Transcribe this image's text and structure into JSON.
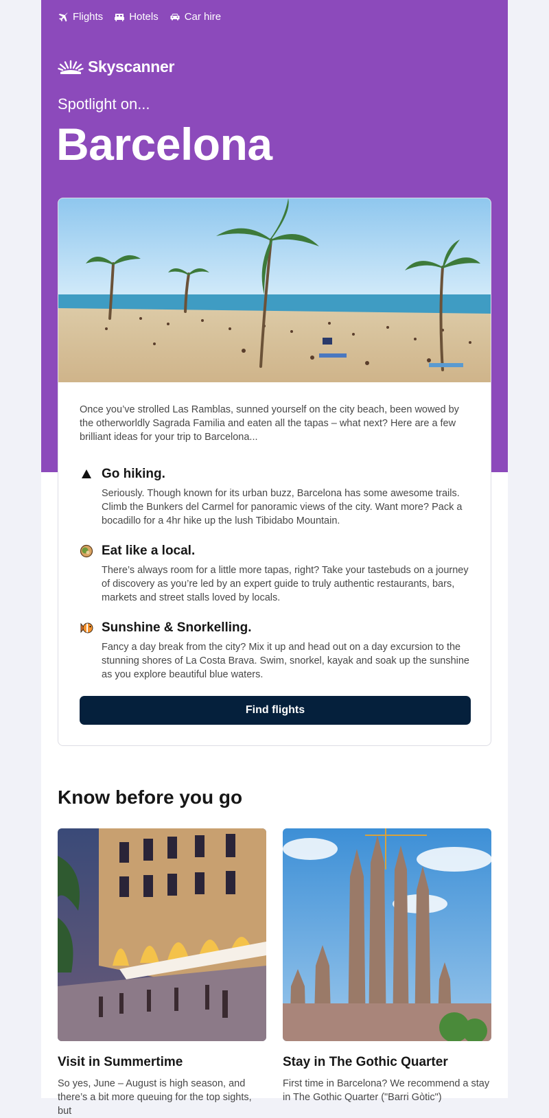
{
  "nav": {
    "items": [
      {
        "label": "Flights",
        "icon": "plane-icon"
      },
      {
        "label": "Hotels",
        "icon": "bed-icon"
      },
      {
        "label": "Car hire",
        "icon": "car-icon"
      }
    ]
  },
  "brand": {
    "name": "Skyscanner",
    "color": "#8c4abb"
  },
  "hero": {
    "kicker": "Spotlight on...",
    "city": "Barcelona"
  },
  "intro": "Once you’ve strolled Las Ramblas, sunned yourself on the city beach, been wowed by the otherworldly Sagrada Familia and eaten all the tapas – what next? Here are a few brilliant ideas for your trip to Barcelona...",
  "tips": [
    {
      "icon": "mountain-icon",
      "title": "Go hiking.",
      "body": "Seriously. Though known for its urban buzz, Barcelona has some awesome trails. Climb the Bunkers del Carmel for panoramic views of the city. Want more? Pack a bocadillo for a 4hr hike up the lush Tibidabo Mountain."
    },
    {
      "icon": "food-bowl-icon",
      "title": "Eat like a local.",
      "body": "There’s always room for a little more tapas, right? Take your tastebuds on a journey of discovery as you’re led by an expert guide to truly authentic restaurants, bars, markets and street stalls loved by locals."
    },
    {
      "icon": "tropical-fish-icon",
      "title": "Sunshine & Snorkelling.",
      "body": "Fancy a day break from the city? Mix it up and head out on a day excursion to the stunning shores of La Costa Brava. Swim, snorkel, kayak and soak up the sunshine as you explore beautiful blue waters."
    }
  ],
  "cta": {
    "label": "Find flights",
    "color": "#05203c"
  },
  "know": {
    "title": "Know before you go",
    "cards": [
      {
        "title": "Visit in Summertime",
        "body": "So yes, June – August is high season, and there’s a bit more queuing for the top sights, but"
      },
      {
        "title": "Stay in The Gothic Quarter",
        "body": "First time in Barcelona? We recommend a stay in The Gothic Quarter (\"Barri Gòtic\")"
      }
    ]
  }
}
